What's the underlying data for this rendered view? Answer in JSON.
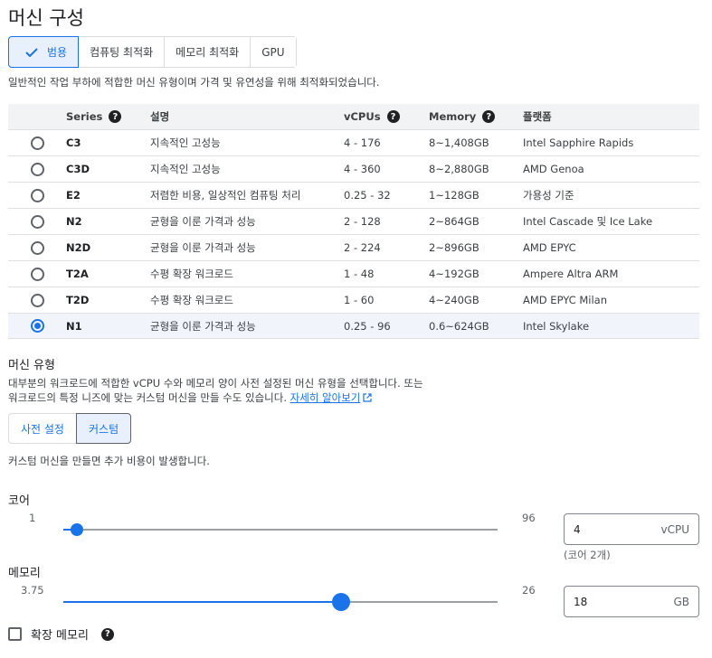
{
  "page": {
    "title": "머신 구성"
  },
  "family_tabs": [
    {
      "label": "범용",
      "selected": true
    },
    {
      "label": "컴퓨팅 최적화",
      "selected": false
    },
    {
      "label": "메모리 최적화",
      "selected": false
    },
    {
      "label": "GPU",
      "selected": false
    }
  ],
  "family_desc": "일반적인 작업 부하에 적합한 머신 유형이며 가격 및 유연성을 위해 최적화되었습니다.",
  "table": {
    "headers": {
      "series": "Series",
      "desc": "설명",
      "vcpus": "vCPUs",
      "memory": "Memory",
      "platform": "플랫폼"
    },
    "rows": [
      {
        "series": "C3",
        "desc": "지속적인 고성능",
        "vcpus": "4 - 176",
        "memory": "8~1,408GB",
        "platform": "Intel Sapphire Rapids",
        "selected": false
      },
      {
        "series": "C3D",
        "desc": "지속적인 고성능",
        "vcpus": "4 - 360",
        "memory": "8~2,880GB",
        "platform": "AMD Genoa",
        "selected": false
      },
      {
        "series": "E2",
        "desc": "저렴한 비용, 일상적인 컴퓨팅 처리",
        "vcpus": "0.25 - 32",
        "memory": "1~128GB",
        "platform": "가용성 기준",
        "selected": false
      },
      {
        "series": "N2",
        "desc": "균형을 이룬 가격과 성능",
        "vcpus": "2 - 128",
        "memory": "2~864GB",
        "platform": "Intel Cascade 및 Ice Lake",
        "selected": false
      },
      {
        "series": "N2D",
        "desc": "균형을 이룬 가격과 성능",
        "vcpus": "2 - 224",
        "memory": "2~896GB",
        "platform": "AMD EPYC",
        "selected": false
      },
      {
        "series": "T2A",
        "desc": "수평 확장 워크로드",
        "vcpus": "1 - 48",
        "memory": "4~192GB",
        "platform": "Ampere Altra ARM",
        "selected": false
      },
      {
        "series": "T2D",
        "desc": "수평 확장 워크로드",
        "vcpus": "1 - 60",
        "memory": "4~240GB",
        "platform": "AMD EPYC Milan",
        "selected": false
      },
      {
        "series": "N1",
        "desc": "균형을 이룬 가격과 성능",
        "vcpus": "0.25 - 96",
        "memory": "0.6~624GB",
        "platform": "Intel Skylake",
        "selected": true
      }
    ]
  },
  "machine_type": {
    "title": "머신 유형",
    "desc_line1": "대부분의 워크로드에 적합한 vCPU 수와 메모리 양이 사전 설정된 머신 유형을 선택합니다. 또는",
    "desc_line2": "워크로드의 특정 니즈에 맞는 커스텀 머신을 만들 수도 있습니다.",
    "learn_more": "자세히 알아보기",
    "tabs": [
      {
        "label": "사전 설정",
        "selected": false
      },
      {
        "label": "커스텀",
        "selected": true
      }
    ],
    "cost_note": "커스텀 머신을 만들면 추가 비용이 발생합니다."
  },
  "cores": {
    "label": "코어",
    "min": "1",
    "max": "96",
    "min_value": 1,
    "max_value": 96,
    "value": 4,
    "field_value": "4",
    "unit": "vCPU",
    "hint": "(코어 2개)"
  },
  "memory": {
    "label": "메모리",
    "min": "3.75",
    "max": "26",
    "min_value": 3.75,
    "max_value": 26,
    "value": 18,
    "field_value": "18",
    "unit": "GB"
  },
  "extended_memory": {
    "label": "확장 메모리",
    "checked": false
  },
  "colors": {
    "accent": "#1a73e8",
    "selected_bg": "#e8f0fe"
  },
  "help_glyph": "?"
}
